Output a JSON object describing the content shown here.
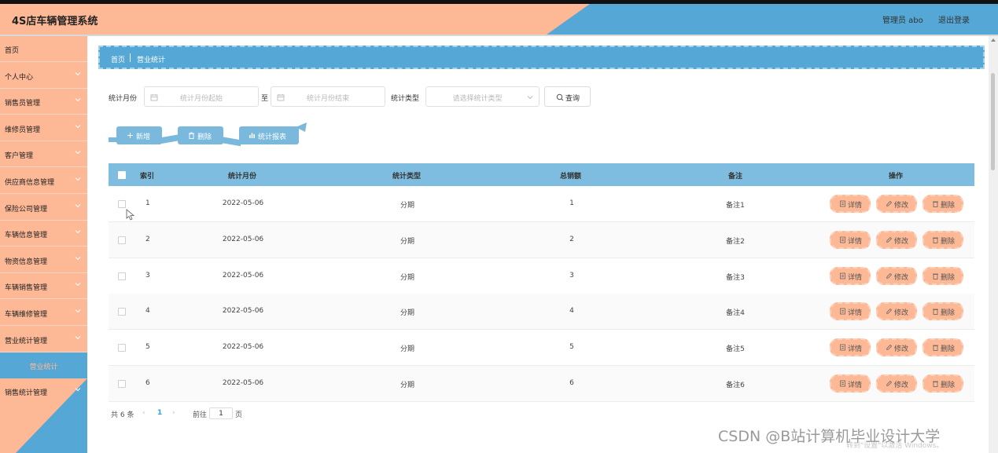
{
  "header": {
    "title": "4S店车辆管理系统",
    "admin": "管理员 abo",
    "logout": "退出登录"
  },
  "sidebar": {
    "items": [
      {
        "label": "首页",
        "chevron": false
      },
      {
        "label": "个人中心",
        "chevron": true
      },
      {
        "label": "销售员管理",
        "chevron": true
      },
      {
        "label": "维修员管理",
        "chevron": true
      },
      {
        "label": "客户管理",
        "chevron": true
      },
      {
        "label": "供应商信息管理",
        "chevron": true
      },
      {
        "label": "保险公司管理",
        "chevron": true
      },
      {
        "label": "车辆信息管理",
        "chevron": true
      },
      {
        "label": "物资信息管理",
        "chevron": true
      },
      {
        "label": "车辆销售管理",
        "chevron": true
      },
      {
        "label": "车辆维修管理",
        "chevron": true
      },
      {
        "label": "营业统计管理",
        "chevron": true
      }
    ],
    "sub_item": "营业统计",
    "last_item": "销售统计管理"
  },
  "breadcrumb": {
    "home": "首页",
    "current": "营业统计"
  },
  "search": {
    "month_label": "统计月份",
    "start_placeholder": "统计月份起始",
    "to": "至",
    "end_placeholder": "统计月份结束",
    "type_label": "统计类型",
    "type_placeholder": "请选择统计类型",
    "query": "查询"
  },
  "actions": {
    "add": "新增",
    "delete": "删除",
    "report": "统计报表"
  },
  "table": {
    "columns": [
      "索引",
      "统计月份",
      "统计类型",
      "总销额",
      "备注",
      "操作"
    ],
    "rows": [
      {
        "index": "1",
        "month": "2022-05-06",
        "type": "分期",
        "total": "1",
        "note": "备注1"
      },
      {
        "index": "2",
        "month": "2022-05-06",
        "type": "分期",
        "total": "2",
        "note": "备注2"
      },
      {
        "index": "3",
        "month": "2022-05-06",
        "type": "分期",
        "total": "3",
        "note": "备注3"
      },
      {
        "index": "4",
        "month": "2022-05-06",
        "type": "分期",
        "total": "4",
        "note": "备注4"
      },
      {
        "index": "5",
        "month": "2022-05-06",
        "type": "分期",
        "total": "5",
        "note": "备注5"
      },
      {
        "index": "6",
        "month": "2022-05-06",
        "type": "分期",
        "total": "6",
        "note": "备注6"
      }
    ],
    "op_labels": {
      "detail": "详情",
      "edit": "修改",
      "delete": "删除"
    }
  },
  "pagination": {
    "total": "共 6 条",
    "current": "1",
    "goto": "前往",
    "page_value": "1",
    "page_suffix": "页"
  },
  "watermark": {
    "main": "CSDN @B站计算机毕业设计大学",
    "sub": "转到\"设置\"以激活 Windows。"
  },
  "colors": {
    "peach": "#fdb896",
    "blue": "#55a7d5",
    "table_header": "#7ebde0"
  }
}
